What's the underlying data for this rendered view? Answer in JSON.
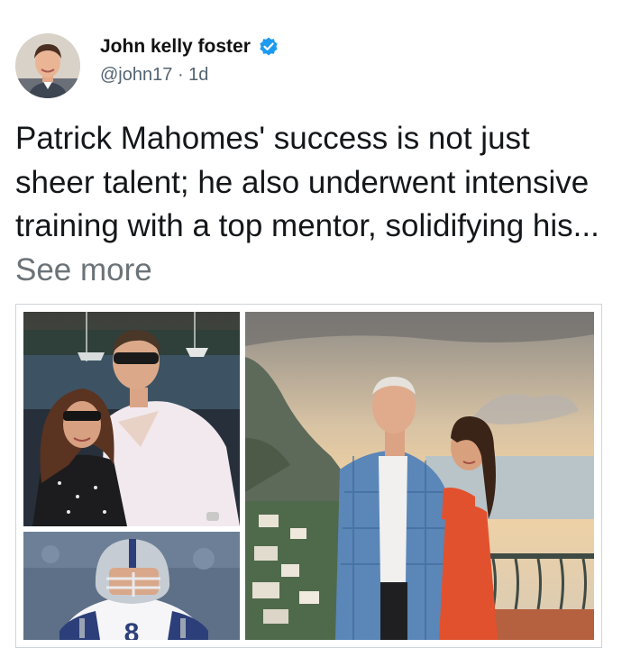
{
  "post": {
    "author": {
      "display_name": "John kelly foster",
      "handle": "@john17",
      "separator": "·",
      "time_ago": "1d",
      "verified": true
    },
    "text": {
      "body": "Patrick Mahomes' success is not just sheer talent; he also underwent intensive training with a top mentor, solidifying his...",
      "see_more": "See more"
    },
    "media": {
      "photos": [
        "couple-at-marina-photo",
        "football-quarterback-photo",
        "couple-on-terrace-photo"
      ],
      "jersey_number": "8"
    }
  },
  "colors": {
    "verified_badge": "#1d9bf0",
    "secondary_text": "#536471",
    "see_more": "#6b7378",
    "media_border": "#cfd4d8"
  }
}
